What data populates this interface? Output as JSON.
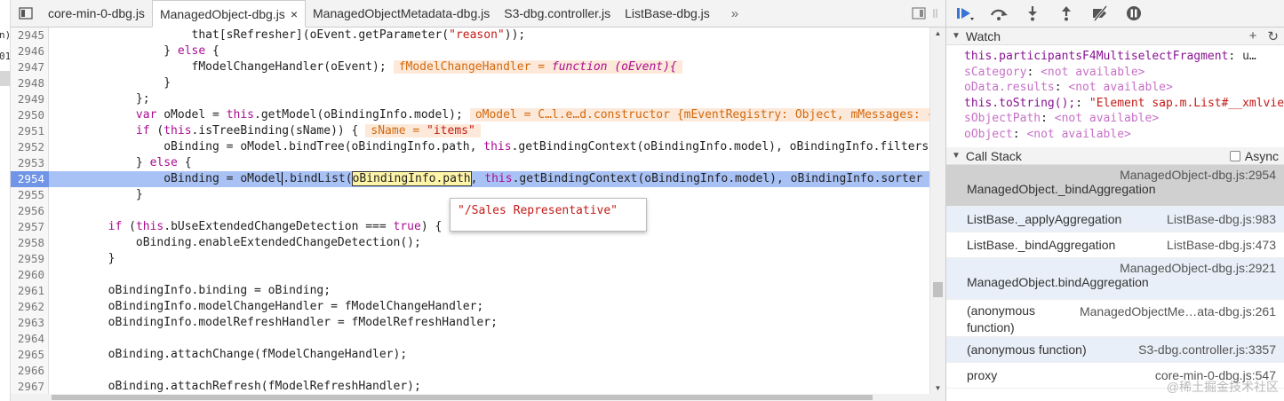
{
  "left_gutter": {
    "labels": [
      "n)",
      "01"
    ]
  },
  "tabs": [
    {
      "label": "core-min-0-dbg.js",
      "active": false
    },
    {
      "label": "ManagedObject-dbg.js",
      "active": true,
      "close": "×"
    },
    {
      "label": "ManagedObjectMetadata-dbg.js",
      "active": false
    },
    {
      "label": "S3-dbg.controller.js",
      "active": false
    },
    {
      "label": "ListBase-dbg.js",
      "active": false
    }
  ],
  "tab_overflow": "»",
  "code": {
    "lines": [
      {
        "n": "2945",
        "parts": [
          {
            "t": "                    that[sRefresher](oEvent.getParameter("
          },
          {
            "t": "\"reason\"",
            "c": "str"
          },
          {
            "t": "));"
          }
        ]
      },
      {
        "n": "2946",
        "parts": [
          {
            "t": "                } "
          },
          {
            "t": "else",
            "c": "kw"
          },
          {
            "t": " {"
          }
        ]
      },
      {
        "n": "2947",
        "parts": [
          {
            "t": "                    fModelChangeHandler(oEvent);"
          }
        ],
        "inline": {
          "pre": "fModelChangeHandler = ",
          "fn": "function (oEvent){"
        }
      },
      {
        "n": "2948",
        "parts": [
          {
            "t": "                }"
          }
        ]
      },
      {
        "n": "2949",
        "parts": [
          {
            "t": "            };"
          }
        ]
      },
      {
        "n": "2950",
        "parts": [
          {
            "t": "            "
          },
          {
            "t": "var",
            "c": "kw"
          },
          {
            "t": " oModel = "
          },
          {
            "t": "this",
            "c": "kw"
          },
          {
            "t": ".getModel(oBindingInfo.model);"
          }
        ],
        "inline": {
          "pre": "oModel = C…l.e…d.constructor {mEventRegistry: Object, mMessages: {…"
        }
      },
      {
        "n": "2951",
        "parts": [
          {
            "t": "            "
          },
          {
            "t": "if",
            "c": "kw"
          },
          {
            "t": " ("
          },
          {
            "t": "this",
            "c": "kw"
          },
          {
            "t": ".isTreeBinding(sName)) {"
          }
        ],
        "inline": {
          "pre": "sName = ",
          "str": "\"items\""
        }
      },
      {
        "n": "2952",
        "parts": [
          {
            "t": "                oBinding = oModel.bindTree(oBindingInfo.path, "
          },
          {
            "t": "this",
            "c": "kw"
          },
          {
            "t": ".getBindingContext(oBindingInfo.model), oBindingInfo.filters"
          }
        ]
      },
      {
        "n": "2953",
        "parts": [
          {
            "t": "            } "
          },
          {
            "t": "else",
            "c": "kw"
          },
          {
            "t": " {"
          }
        ]
      },
      {
        "n": "2954",
        "exec": true,
        "parts": [
          {
            "t": "                oBinding = oModel"
          },
          {
            "t": "",
            "c": "cursor"
          },
          {
            "t": ".bindList("
          },
          {
            "t": "oBindingInfo.path",
            "c": "hl"
          },
          {
            "t": ", "
          },
          {
            "t": "this",
            "c": "kw"
          },
          {
            "t": ".getBindingContext(oBindingInfo.model), oBindingInfo.sorter"
          }
        ]
      },
      {
        "n": "2955",
        "parts": [
          {
            "t": "            }"
          }
        ]
      },
      {
        "n": "2956",
        "parts": [
          {
            "t": ""
          }
        ]
      },
      {
        "n": "2957",
        "parts": [
          {
            "t": "        "
          },
          {
            "t": "if",
            "c": "kw"
          },
          {
            "t": " ("
          },
          {
            "t": "this",
            "c": "kw"
          },
          {
            "t": ".bUseExtendedChangeDetection === "
          },
          {
            "t": "true",
            "c": "kw"
          },
          {
            "t": ") {"
          }
        ]
      },
      {
        "n": "2958",
        "parts": [
          {
            "t": "            oBinding.enableExtendedChangeDetection();"
          }
        ]
      },
      {
        "n": "2959",
        "parts": [
          {
            "t": "        }"
          }
        ]
      },
      {
        "n": "2960",
        "parts": [
          {
            "t": ""
          }
        ]
      },
      {
        "n": "2961",
        "parts": [
          {
            "t": "        oBindingInfo.binding = oBinding;"
          }
        ]
      },
      {
        "n": "2962",
        "parts": [
          {
            "t": "        oBindingInfo.modelChangeHandler = fModelChangeHandler;"
          }
        ]
      },
      {
        "n": "2963",
        "parts": [
          {
            "t": "        oBindingInfo.modelRefreshHandler = fModelRefreshHandler;"
          }
        ]
      },
      {
        "n": "2964",
        "parts": [
          {
            "t": ""
          }
        ]
      },
      {
        "n": "2965",
        "parts": [
          {
            "t": "        oBinding.attachChange(fModelChangeHandler);"
          }
        ]
      },
      {
        "n": "2966",
        "parts": [
          {
            "t": ""
          }
        ]
      },
      {
        "n": "2967",
        "parts": [
          {
            "t": "        oBinding.attachRefresh(fModelRefreshHandler);"
          }
        ]
      }
    ]
  },
  "tooltip": {
    "value": "\"/Sales Representative\""
  },
  "watch": {
    "title": "Watch",
    "add": "+",
    "refresh": "↻",
    "items": [
      {
        "name": "this.participantsF4MultiselectFragment",
        "value": "u…",
        "kind": "val",
        "name_na": false
      },
      {
        "name": "sCategory",
        "value": "<not available>",
        "kind": "na",
        "name_na": true
      },
      {
        "name": "oData.results",
        "value": "<not available>",
        "kind": "na",
        "name_na": true
      },
      {
        "name": "this.toString();",
        "value": "\"Element sap.m.List#__xmlview…",
        "kind": "str",
        "name_na": false
      },
      {
        "name": "sObjectPath",
        "value": "<not available>",
        "kind": "na",
        "name_na": true
      },
      {
        "name": "oObject",
        "value": "<not available>",
        "kind": "na",
        "name_na": true
      }
    ]
  },
  "callstack": {
    "title": "Call Stack",
    "async_label": "Async",
    "frames": [
      {
        "fn": "ManagedObject._bindAggregation",
        "loc": "ManagedObject-dbg.js:2954",
        "layout": "double",
        "state": "selected"
      },
      {
        "fn": "ListBase._applyAggregation",
        "loc": "ListBase-dbg.js:983",
        "layout": "single",
        "state": "hover"
      },
      {
        "fn": "ListBase._bindAggregation",
        "loc": "ListBase-dbg.js:473",
        "layout": "single",
        "state": ""
      },
      {
        "fn": "ManagedObject.bindAggregation",
        "loc": "ManagedObject-dbg.js:2921",
        "layout": "double",
        "state": "hover"
      },
      {
        "fn": "(anonymous function)",
        "loc": "ManagedObjectMe…ata-dbg.js:261",
        "layout": "anon",
        "state": ""
      },
      {
        "fn": "(anonymous function)",
        "loc": "S3-dbg.controller.js:3357",
        "layout": "single",
        "state": "hover"
      },
      {
        "fn": "proxy",
        "loc": "core-min-0-dbg.js:547",
        "layout": "single",
        "state": ""
      }
    ]
  },
  "watermark": "@稀土掘金技术社区"
}
